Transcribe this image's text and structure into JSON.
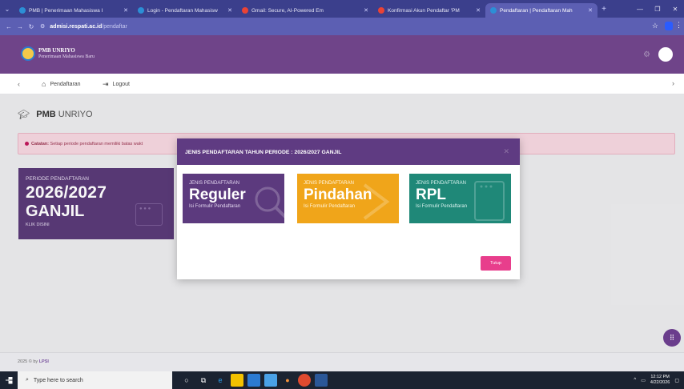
{
  "browser": {
    "tabs": [
      {
        "title": "PMB | Penerimaan Mahasiswa I",
        "color": "#2c8fd6",
        "active": false
      },
      {
        "title": "Login - Pendaftaran Mahasisw",
        "color": "#2c8fd6",
        "active": false
      },
      {
        "title": "Gmail: Secure, AI-Powered Em",
        "color": "#ea4335",
        "active": false
      },
      {
        "title": "Konfirmasi Akun Pendaftar 'PM",
        "color": "#ea4335",
        "active": false
      },
      {
        "title": "Pendaftaran | Pendaftaran Mah",
        "color": "#2c8fd6",
        "active": true
      }
    ],
    "url_host": "admisi.respati.ac.id",
    "url_path": "/pendaftar"
  },
  "app": {
    "brand_title": "PMB UNRIYO",
    "brand_subtitle": "Penerimaan Mahasiswa Baru"
  },
  "subnav": {
    "home_label": "Pendaftaran",
    "logout_label": "Logout"
  },
  "page": {
    "title_bold": "PMB",
    "title_rest": "UNRIYO",
    "note_label": "Catatan:",
    "note_text": "Setiap periode pendaftaran memiliki batas wakt"
  },
  "period_card": {
    "label": "PERIODE PENDAFTARAN",
    "year": "2026/2027",
    "semester": "GANJIL",
    "cta": "KLIK DISINI"
  },
  "modal": {
    "title": "JENIS PENDAFTARAN TAHUN PERIODE : 2026/2027 GANJIL",
    "options": [
      {
        "kicker": "JENIS PENDAFTARAN",
        "name": "Reguler",
        "sub": "Isi Formulir Pendaftaran"
      },
      {
        "kicker": "JENIS PENDAFTARAN",
        "name": "Pindahan",
        "sub": "Isi Formulir Pendaftaran"
      },
      {
        "kicker": "JENIS PENDAFTARAN",
        "name": "RPL",
        "sub": "Isi Formulir Pendaftaran"
      }
    ],
    "close_label": "Tutup"
  },
  "footer": {
    "prefix": "2025 © by",
    "org": "LPSI"
  },
  "taskbar": {
    "search_placeholder": "Type here to search",
    "time": "12:12 PM",
    "date": "4/22/2026"
  }
}
